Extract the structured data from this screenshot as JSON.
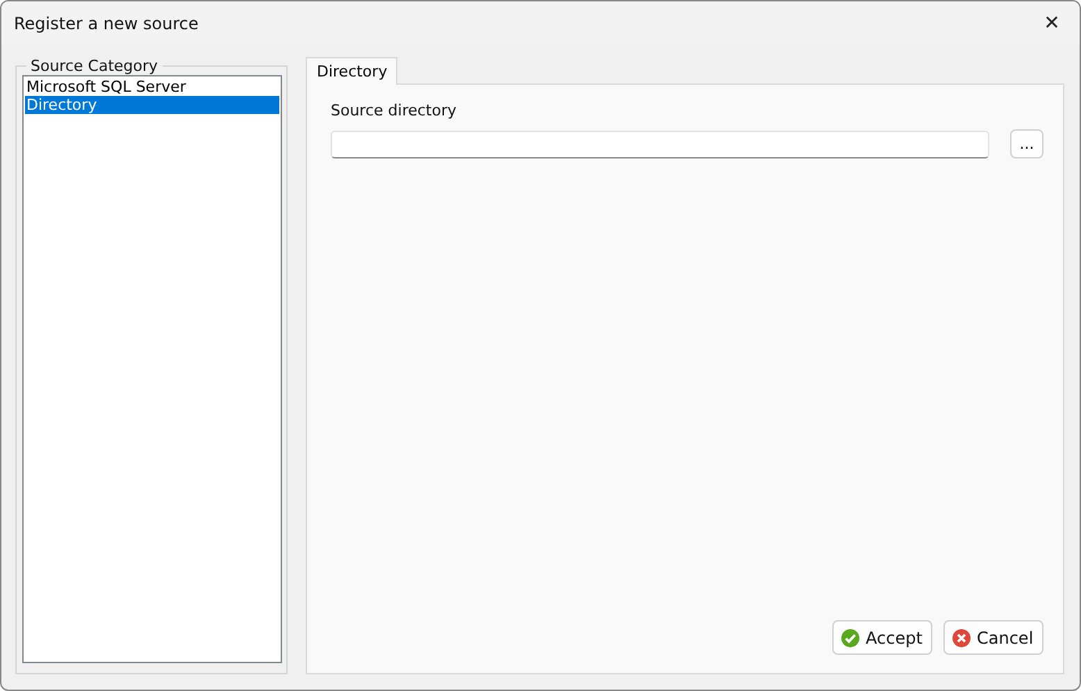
{
  "window": {
    "title": "Register a new source",
    "close": "✕"
  },
  "source_category": {
    "label": "Source Category",
    "items": [
      {
        "label": "Microsoft SQL Server",
        "selected": false
      },
      {
        "label": "Directory",
        "selected": true
      }
    ]
  },
  "tabs": [
    {
      "label": "Directory",
      "selected": true
    }
  ],
  "source_directory": {
    "label": "Source directory",
    "browse": "..."
  },
  "buttons": [
    {
      "label": "Accept",
      "kind": "accept"
    },
    {
      "label": "Cancel",
      "kind": "cancel"
    }
  ]
}
